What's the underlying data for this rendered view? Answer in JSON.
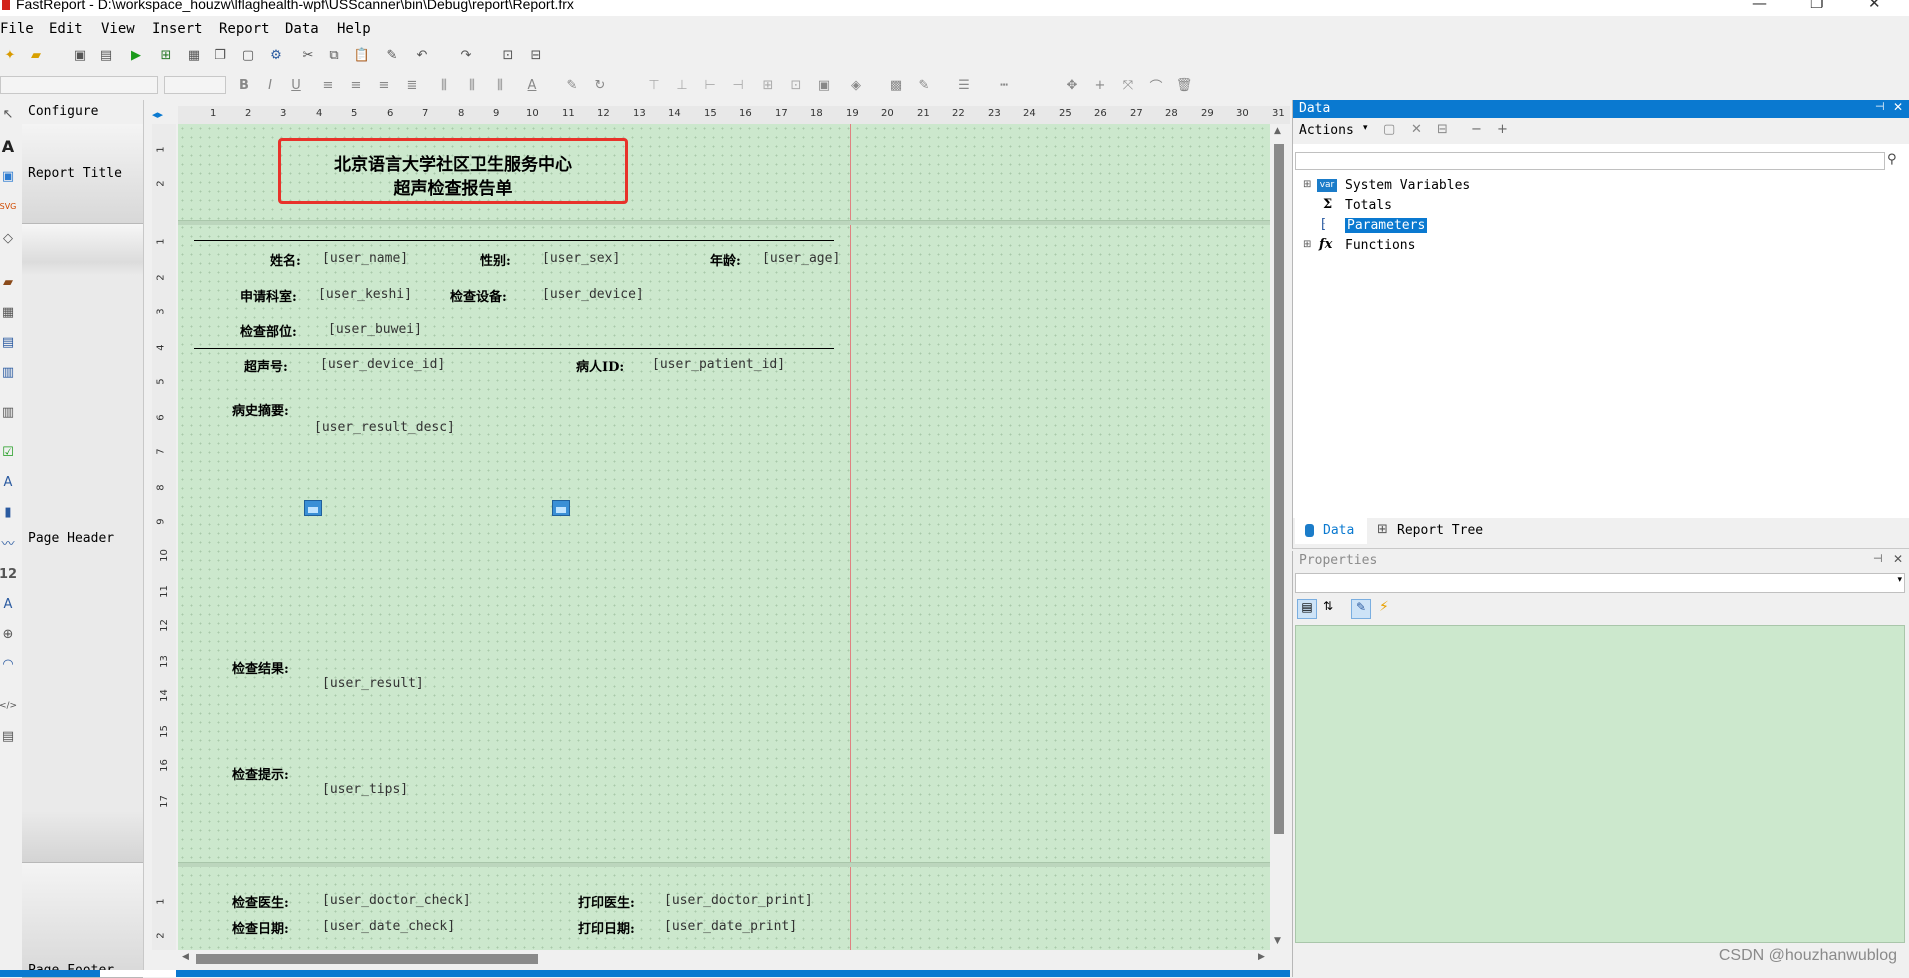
{
  "window": {
    "title": "FastReport - D:\\workspace_houzw\\lflaghealth-wpf\\USScanner\\bin\\Debug\\report\\Report.frx",
    "minimize": "—",
    "maximize": "❐",
    "close": "✕"
  },
  "menu": [
    "File",
    "Edit",
    "View",
    "Insert",
    "Report",
    "Data",
    "Help"
  ],
  "bands": {
    "configure": "Configure",
    "report_title": "Report Title",
    "page_header": "Page Header",
    "page_footer": "Page Footer"
  },
  "ruler": {
    "h": [
      "1",
      "2",
      "3",
      "4",
      "5",
      "6",
      "7",
      "8",
      "9",
      "10",
      "11",
      "12",
      "13",
      "14",
      "15",
      "16",
      "17",
      "18",
      "19",
      "20",
      "21",
      "22",
      "23",
      "24",
      "25",
      "26",
      "27",
      "28",
      "29",
      "30",
      "31"
    ],
    "v_title": [
      "1",
      "2"
    ],
    "v_header": [
      "1",
      "2",
      "3",
      "4",
      "5",
      "6",
      "7",
      "8",
      "9",
      "10",
      "11",
      "12",
      "13",
      "14",
      "15",
      "16",
      "17"
    ],
    "v_footer": [
      "1",
      "2"
    ]
  },
  "report": {
    "title_line1": "北京语言大学社区卫生服务中心",
    "title_line2": "超声检查报告单",
    "name_label": "姓名:",
    "name_field": "[user_name]",
    "sex_label": "性别:",
    "sex_field": "[user_sex]",
    "age_label": "年龄:",
    "age_field": "[user_age]",
    "dept_label": "申请科室:",
    "dept_field": "[user_keshi]",
    "device_label": "检查设备:",
    "device_field": "[user_device]",
    "part_label": "检查部位:",
    "part_field": "[user_buwei]",
    "us_label": "超声号:",
    "us_field": "[user_device_id]",
    "pid_label": "病人ID:",
    "pid_field": "[user_patient_id]",
    "history_label": "病史摘要:",
    "history_field": "[user_result_desc]",
    "result_label": "检查结果:",
    "result_field": "[user_result]",
    "tips_label": "检查提示:",
    "tips_field": "[user_tips]",
    "doctor_check_label": "检查医生:",
    "doctor_check_field": "[user_doctor_check]",
    "doctor_print_label": "打印医生:",
    "doctor_print_field": "[user_doctor_print]",
    "date_check_label": "检查日期:",
    "date_check_field": "[user_date_check]",
    "date_print_label": "打印日期:",
    "date_print_field": "[user_date_print]"
  },
  "data_panel": {
    "title": "Data",
    "actions": "Actions",
    "tree": [
      {
        "label": "System Variables",
        "icon": "var-icon"
      },
      {
        "label": "Totals",
        "icon": "sigma-icon"
      },
      {
        "label": "Parameters",
        "icon": "parameters-icon"
      },
      {
        "label": "Functions",
        "icon": "fx-icon"
      }
    ],
    "tab_data": "Data",
    "tab_report_tree": "Report Tree"
  },
  "properties_panel": {
    "title": "Properties"
  },
  "watermark": "CSDN @houzhanwublog",
  "colors": {
    "accent": "#0a79d0",
    "page_bg": "#cce8cd",
    "highlight_box": "#e8322a"
  }
}
